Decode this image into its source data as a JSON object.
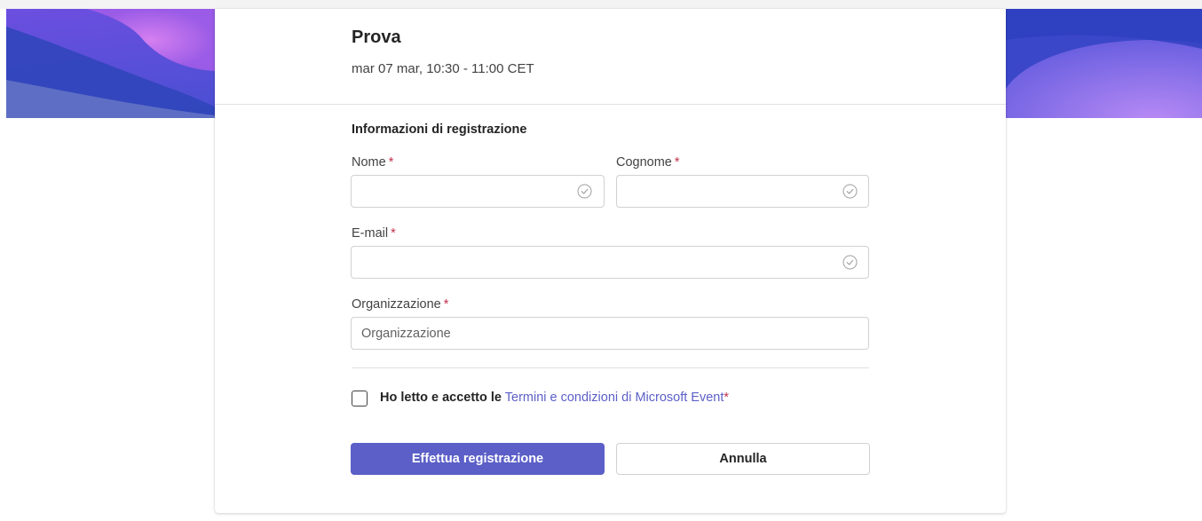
{
  "event": {
    "title": "Prova",
    "datetime": "mar 07 mar, 10:30 - 11:00 CET"
  },
  "form": {
    "section_title": "Informazioni di registrazione",
    "required_marker": "*",
    "fields": {
      "first_name": {
        "label": "Nome",
        "value": "",
        "placeholder": ""
      },
      "last_name": {
        "label": "Cognome",
        "value": "",
        "placeholder": ""
      },
      "email": {
        "label": "E-mail",
        "value": "",
        "placeholder": ""
      },
      "organization": {
        "label": "Organizzazione",
        "value": "",
        "placeholder": "Organizzazione"
      }
    },
    "terms": {
      "checked": false,
      "prefix": "Ho letto e accetto le",
      "link_text": "Termini e condizioni di Microsoft Event",
      "suffix": "*"
    },
    "buttons": {
      "submit_label": "Effettua registrazione",
      "cancel_label": "Annulla"
    }
  },
  "icons": {
    "field_status": "check-circle-icon"
  },
  "colors": {
    "accent": "#5b5fc7",
    "required": "#c4314b",
    "banner_purple": "#5a4fd0",
    "banner_blue": "#3d52c8"
  }
}
